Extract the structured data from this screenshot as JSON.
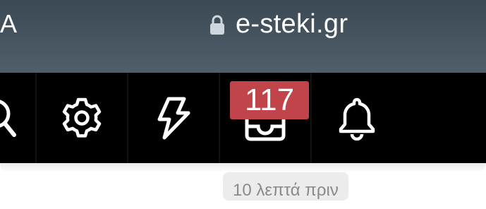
{
  "browser": {
    "text_size_label": "A",
    "url": "e-steki.gr"
  },
  "toolbar": {
    "items": [
      {
        "icon": "search-icon"
      },
      {
        "icon": "gear-icon"
      },
      {
        "icon": "lightning-icon"
      },
      {
        "icon": "inbox-icon",
        "badge": "117"
      },
      {
        "icon": "bell-icon"
      }
    ],
    "badge_color": "#c0444a"
  },
  "page": {
    "timestamp": "10 λεπτά πριν"
  }
}
